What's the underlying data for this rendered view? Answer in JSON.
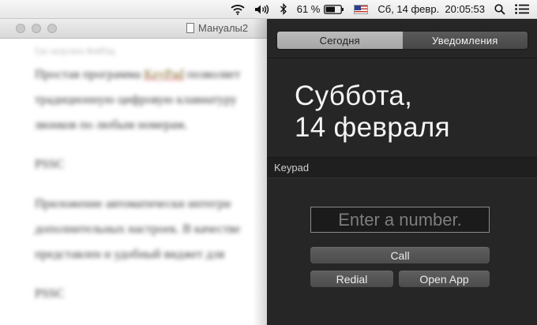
{
  "menubar": {
    "battery_percent": "61 %",
    "datetime": "Сб, 14 февр.  20:05:53",
    "icons": [
      "wifi-icon",
      "volume-icon",
      "bluetooth-icon",
      "battery-icon",
      "us-flag-icon",
      "spotlight-search-icon",
      "notification-center-icon"
    ]
  },
  "document": {
    "title": "Мануалы2",
    "paragraphs": [
      {
        "small": "Где загрузить КейПэд"
      },
      {
        "pre": "Простая программа ",
        "link": "KeyPad",
        "post": " позволяет"
      },
      {
        "text": "традиционную цифровую клавиатуру"
      },
      {
        "text": "звонков по любым номерам."
      },
      {
        "text": "PSSC"
      },
      {
        "text": "Приложение автоматически интегри"
      },
      {
        "text": "дополнительных настроек. В качестве"
      },
      {
        "text": "представлен и удобный виджет для"
      },
      {
        "text": "PSSC"
      }
    ]
  },
  "notification_center": {
    "tabs": [
      {
        "label": "Сегодня",
        "active": true
      },
      {
        "label": "Уведомления",
        "active": false
      }
    ],
    "date_line1": "Суббота,",
    "date_line2": "14 февраля",
    "widget": {
      "title": "Keypad",
      "input_placeholder": "Enter a number.",
      "call_label": "Call",
      "redial_label": "Redial",
      "open_app_label": "Open App"
    }
  },
  "colors": {
    "panel_bg": "#262626",
    "tab_active": "#b3b3b3",
    "button_bg": "#565656"
  }
}
